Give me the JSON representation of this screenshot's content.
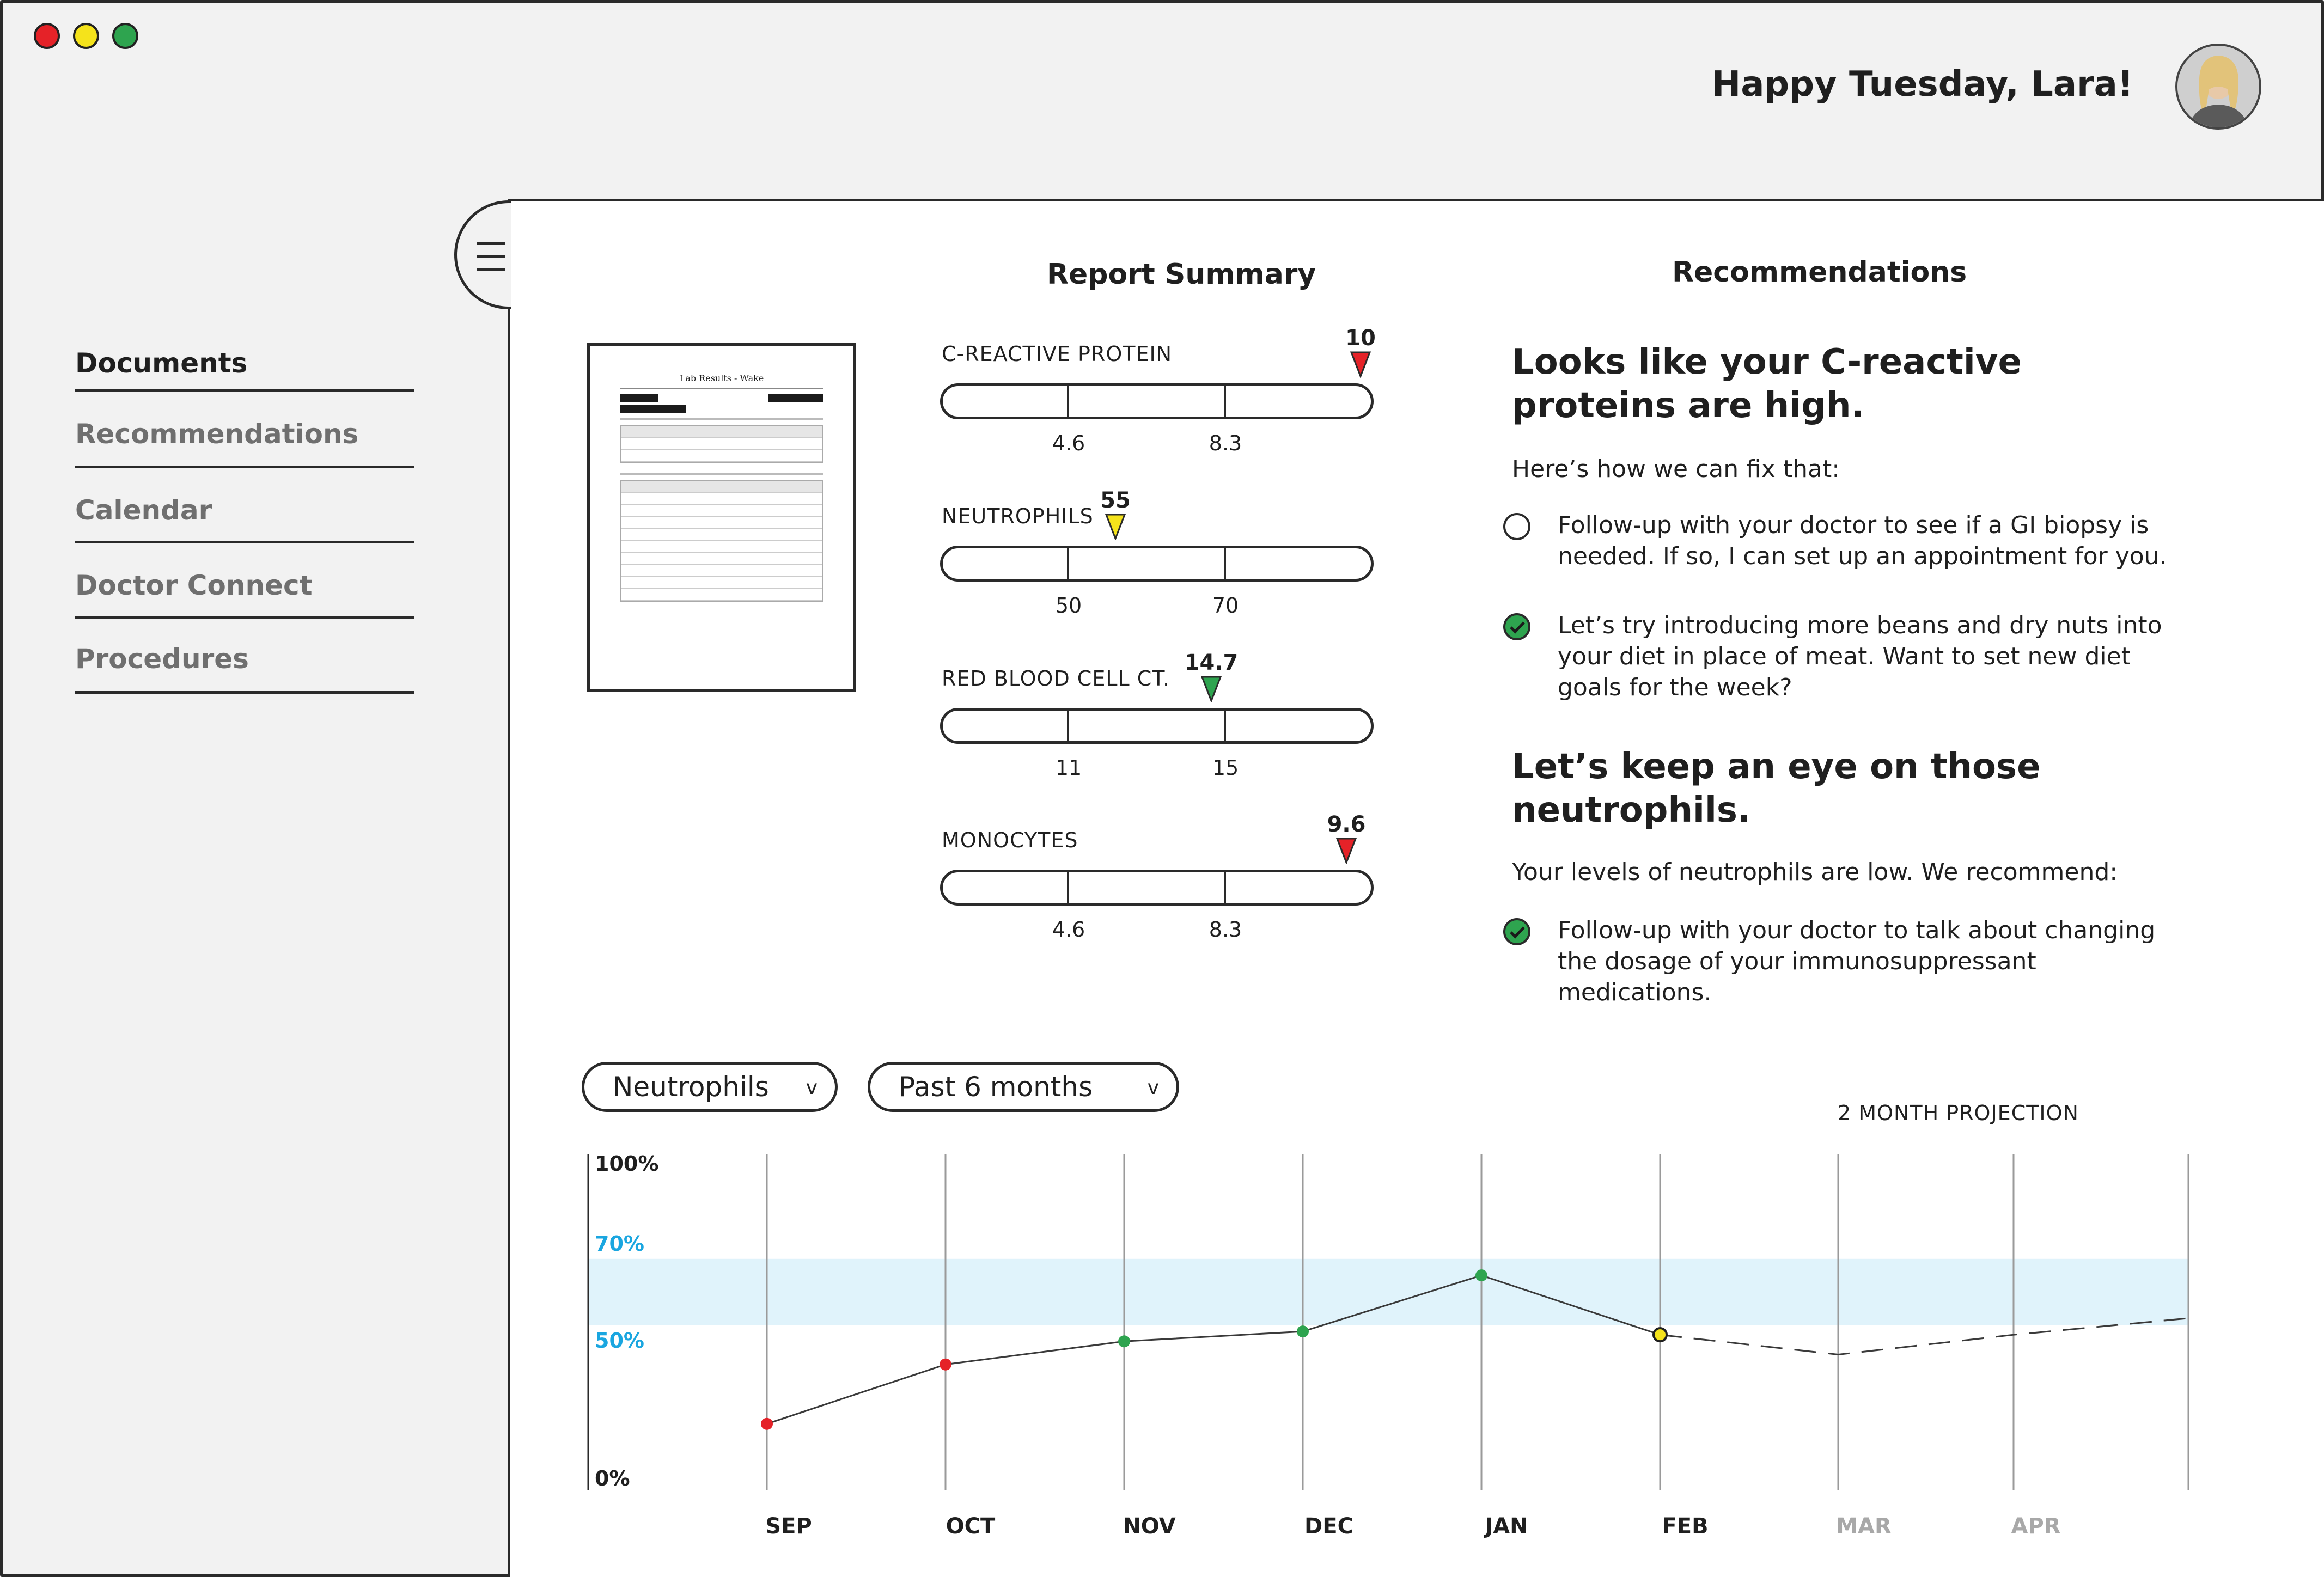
{
  "header": {
    "greeting": "Happy Tuesday, Lara!",
    "avatar_alt": "Lara profile photo"
  },
  "window_controls": [
    "close",
    "minimize",
    "maximize"
  ],
  "sidebar": {
    "items": [
      {
        "label": "Documents",
        "active": true
      },
      {
        "label": "Recommendations",
        "active": false
      },
      {
        "label": "Calendar",
        "active": false
      },
      {
        "label": "Doctor Connect",
        "active": false
      },
      {
        "label": "Procedures",
        "active": false
      }
    ]
  },
  "report": {
    "title": "Report Summary",
    "document": {
      "title": "Lab Results - Wake"
    },
    "labs": [
      {
        "name": "C-REACTIVE PROTEIN",
        "value": "10",
        "tick_low": "4.6",
        "tick_high": "8.3",
        "status": "high",
        "marker_color": "#e52228",
        "position_fraction": 0.97
      },
      {
        "name": "NEUTROPHILS",
        "value": "55",
        "tick_low": "50",
        "tick_high": "70",
        "status": "low",
        "marker_color": "#f5e31b",
        "position_fraction": 0.4
      },
      {
        "name": "RED BLOOD CELL CT.",
        "value": "14.7",
        "tick_low": "11",
        "tick_high": "15",
        "status": "normal",
        "marker_color": "#2ea44f",
        "position_fraction": 0.62
      },
      {
        "name": "MONOCYTES",
        "value": "9.6",
        "tick_low": "4.6",
        "tick_high": "8.3",
        "status": "high",
        "marker_color": "#e52228",
        "position_fraction": 0.93
      }
    ]
  },
  "recommendations": {
    "title": "Recommendations",
    "section1": {
      "heading": "Looks like your C-reactive proteins are high.",
      "intro": "Here’s how we can fix that:",
      "items": [
        {
          "text": "Follow-up with your doctor to see if a GI biopsy is needed. If so, I can set up an appointment for you.",
          "done": false
        },
        {
          "text": "Let’s try introducing more beans and dry nuts into your diet in place of meat. Want to set new diet goals for the week?",
          "done": true
        }
      ]
    },
    "section2": {
      "heading": "Let’s keep an eye on those neutrophils.",
      "intro": "Your levels of neutrophils are low. We recommend:",
      "items": [
        {
          "text": "Follow-up with your doctor to talk about changing the dosage of your immunosuppressant medications.",
          "done": true
        }
      ]
    }
  },
  "filters": {
    "metric": "Neutrophils",
    "range": "Past 6 months",
    "caret": "v"
  },
  "projection_label": "2 MONTH PROJECTION",
  "colors": {
    "normal_band": "#e0f3fb",
    "band_label": "#1aa6e0",
    "red": "#e52228",
    "yellow": "#f5e31b",
    "green": "#2ea44f",
    "future_month": "#a8a8a8"
  },
  "chart_data": {
    "type": "line",
    "categories": [
      "SEP",
      "OCT",
      "NOV",
      "DEC",
      "JAN",
      "FEB",
      "MAR",
      "APR"
    ],
    "y_ticks": [
      "100%",
      "70%",
      "50%",
      "0%"
    ],
    "ylim": [
      0,
      100
    ],
    "normal_range": [
      50,
      70
    ],
    "series": [
      {
        "values": [
          20,
          38,
          45,
          48,
          65,
          47
        ],
        "point_colors": [
          "red",
          "red",
          "green",
          "green",
          "green",
          "yellow"
        ]
      },
      {
        "projection": true,
        "values": [
          47,
          41,
          44,
          47,
          52
        ],
        "x_positions": [
          5,
          6,
          6.5,
          7,
          8
        ]
      }
    ],
    "future_categories": [
      "MAR",
      "APR"
    ]
  }
}
